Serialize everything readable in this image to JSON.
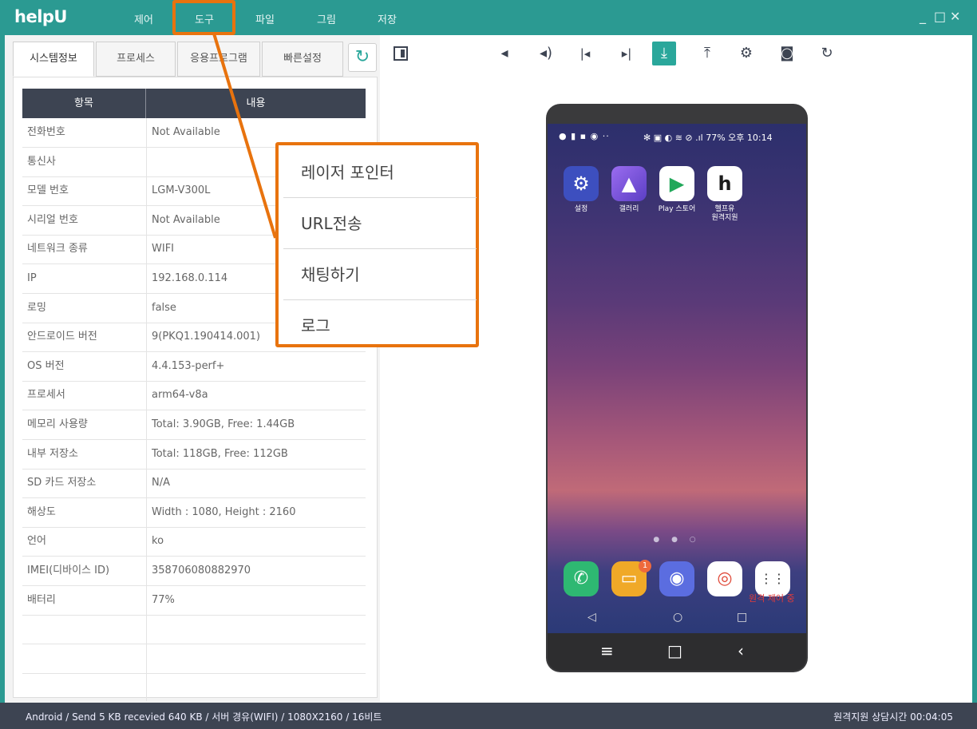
{
  "app": {
    "title": "helpU",
    "menu": [
      "제어",
      "도구",
      "파일",
      "그림",
      "저장"
    ],
    "window_controls": [
      "_",
      "□",
      "✕"
    ]
  },
  "left_panel": {
    "tabs": [
      "시스템정보",
      "프로세스",
      "응용프로그램",
      "빠른설정"
    ],
    "active_tab": "시스템정보",
    "table": {
      "headers": [
        "항목",
        "내용"
      ],
      "rows": [
        {
          "item": "전화번호",
          "value": "Not Available"
        },
        {
          "item": "통신사",
          "value": ""
        },
        {
          "item": "모델 번호",
          "value": "LGM-V300L"
        },
        {
          "item": "시리얼 번호",
          "value": "Not Available"
        },
        {
          "item": "네트워크 종류",
          "value": "WIFI"
        },
        {
          "item": "IP",
          "value": "192.168.0.114"
        },
        {
          "item": "로밍",
          "value": "false"
        },
        {
          "item": "안드로이드 버전",
          "value": "9(PKQ1.190414.001)"
        },
        {
          "item": "OS 버전",
          "value": "4.4.153-perf+"
        },
        {
          "item": "프로세서",
          "value": "arm64-v8a"
        },
        {
          "item": "메모리 사용량",
          "value": "Total: 3.90GB, Free: 1.44GB"
        },
        {
          "item": "내부 저장소",
          "value": "Total: 118GB, Free: 112GB"
        },
        {
          "item": "SD 카드 저장소",
          "value": "N/A"
        },
        {
          "item": "해상도",
          "value": "Width : 1080, Height : 2160"
        },
        {
          "item": "언어",
          "value": "ko"
        },
        {
          "item": "IMEI(디바이스 ID)",
          "value": "358706080882970"
        },
        {
          "item": "배터리",
          "value": "77%"
        }
      ]
    }
  },
  "tools_menu": {
    "items": [
      "레이저 포인터",
      "URL전송",
      "채팅하기",
      "로그"
    ]
  },
  "toolbar": {
    "icons": [
      "volume-down-icon",
      "volume-up-icon",
      "skip-back-icon",
      "skip-forward-icon",
      "download-icon",
      "upload-icon",
      "settings-icon",
      "camera-icon",
      "rotate-icon"
    ]
  },
  "phone": {
    "status_time": "77% 오후 10:14",
    "apps": [
      {
        "label": "설정",
        "icon": "settings-app-icon",
        "color": "#3d4fbf"
      },
      {
        "label": "갤러리",
        "icon": "gallery-app-icon",
        "color": "#7b55d6"
      },
      {
        "label": "Play 스토어",
        "icon": "play-store-icon",
        "color": "#ffffff"
      },
      {
        "label": "헬프유\n원격지원",
        "icon": "helpu-app-icon",
        "color": "#ffffff"
      }
    ],
    "dock_badge": "1",
    "remote_label": "원격 제어 중"
  },
  "statusbar": {
    "left": "Android / Send 5 KB recevied 640 KB / 서버 경유(WIFI) / 1080X2160 / 16비트",
    "right": "원격지원 상담시간 00:04:05"
  },
  "colors": {
    "brand": "#2b9a92",
    "accent": "#2aa79b",
    "highlight": "#e8730e",
    "header_dark": "#3d4452"
  }
}
